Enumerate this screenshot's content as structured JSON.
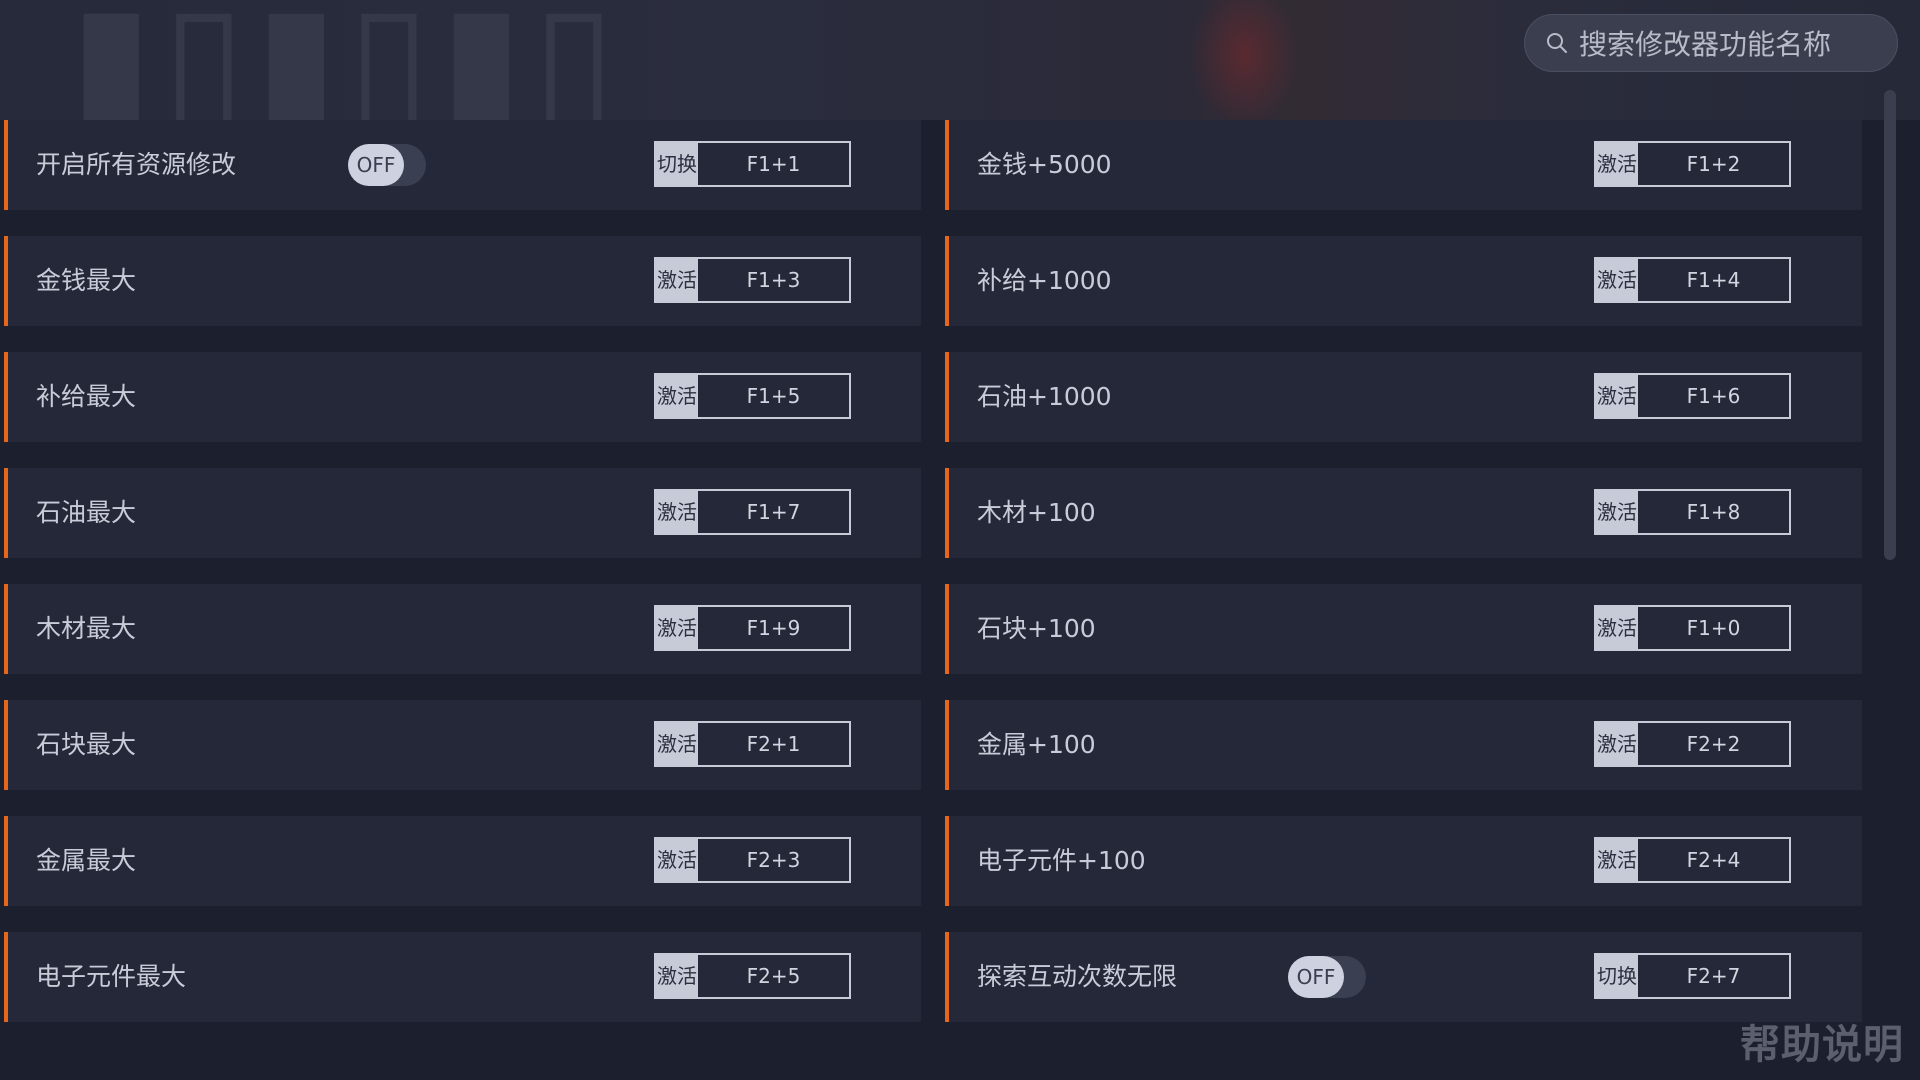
{
  "search": {
    "placeholder": "搜索修改器功能名称"
  },
  "help_label": "帮助说明",
  "accent_color": "#e4671d",
  "rows": [
    {
      "left": {
        "label": "开启所有资源修改",
        "toggle": "OFF",
        "action": "切换",
        "key": "F1+1"
      },
      "right": {
        "label": "金钱+5000",
        "action": "激活",
        "key": "F1+2"
      }
    },
    {
      "left": {
        "label": "金钱最大",
        "action": "激活",
        "key": "F1+3"
      },
      "right": {
        "label": "补给+1000",
        "action": "激活",
        "key": "F1+4"
      }
    },
    {
      "left": {
        "label": "补给最大",
        "action": "激活",
        "key": "F1+5"
      },
      "right": {
        "label": "石油+1000",
        "action": "激活",
        "key": "F1+6"
      }
    },
    {
      "left": {
        "label": "石油最大",
        "action": "激活",
        "key": "F1+7"
      },
      "right": {
        "label": "木材+100",
        "action": "激活",
        "key": "F1+8"
      }
    },
    {
      "left": {
        "label": "木材最大",
        "action": "激活",
        "key": "F1+9"
      },
      "right": {
        "label": "石块+100",
        "action": "激活",
        "key": "F1+0"
      }
    },
    {
      "left": {
        "label": "石块最大",
        "action": "激活",
        "key": "F2+1"
      },
      "right": {
        "label": "金属+100",
        "action": "激活",
        "key": "F2+2"
      }
    },
    {
      "left": {
        "label": "金属最大",
        "action": "激活",
        "key": "F2+3"
      },
      "right": {
        "label": "电子元件+100",
        "action": "激活",
        "key": "F2+4"
      }
    },
    {
      "left": {
        "label": "电子元件最大",
        "action": "激活",
        "key": "F2+5"
      },
      "right": {
        "label": "探索互动次数无限",
        "toggle": "OFF",
        "action": "切换",
        "key": "F2+7"
      }
    }
  ]
}
